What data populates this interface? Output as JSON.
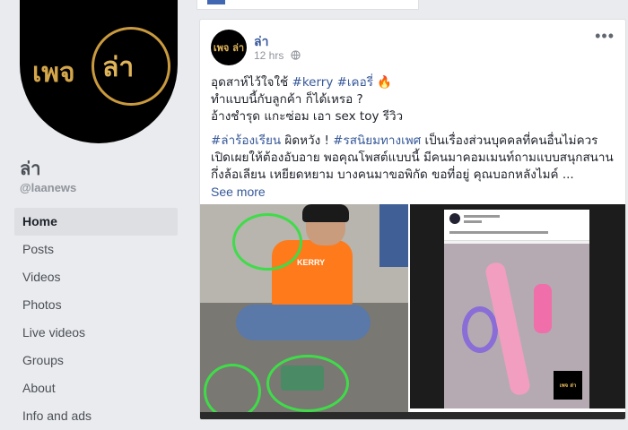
{
  "page": {
    "name": "ล่า",
    "handle": "@laanews",
    "avatar_text_left": "เพจ",
    "avatar_text_right": "ล่า"
  },
  "nav": {
    "items": [
      {
        "label": "Home",
        "active": true
      },
      {
        "label": "Posts"
      },
      {
        "label": "Videos"
      },
      {
        "label": "Photos"
      },
      {
        "label": "Live videos"
      },
      {
        "label": "Groups"
      },
      {
        "label": "About"
      },
      {
        "label": "Info and ads"
      }
    ]
  },
  "post": {
    "avatar_text": "เพจ ล่า",
    "author": "ล่า",
    "time": "12 hrs",
    "more": "•••",
    "line1_prefix": "อุดสาห์ไว้ใจใช้ ",
    "line1_tag1": "#kerry",
    "line1_tag2": "#เคอรี่",
    "line1_emoji": "🔥",
    "line2": "ทำแบบนี้กับลูกค้า ก็ได้เหรอ ?",
    "line3": "อ้างชำรุด แกะซ่อม เอา sex toy รีวิว",
    "para_tag1": "#ล่าร้องเรียน",
    "para_text1": " ผิดหวัง ! ",
    "para_tag2": "#รสนิยมทางเพศ",
    "para_text2": " เป็นเรื่องส่วนบุคคลที่คนอื่นไม่ควรเปิดเผยให้ต้องอับอาย พอคุณโพสต์แบบนี้ มีคนมาคอมเมนท์ถามแบบสนุกสนาน กึ่งล้อเลียน เหยียดหยาม บางคนมาขอพิกัด ขอที่อยู่ คุณบอกหลังไมค์ ...",
    "see_more": "See more",
    "photo1_shirt_text": "KERRY",
    "watermark_text": "เพจ ล่า"
  }
}
